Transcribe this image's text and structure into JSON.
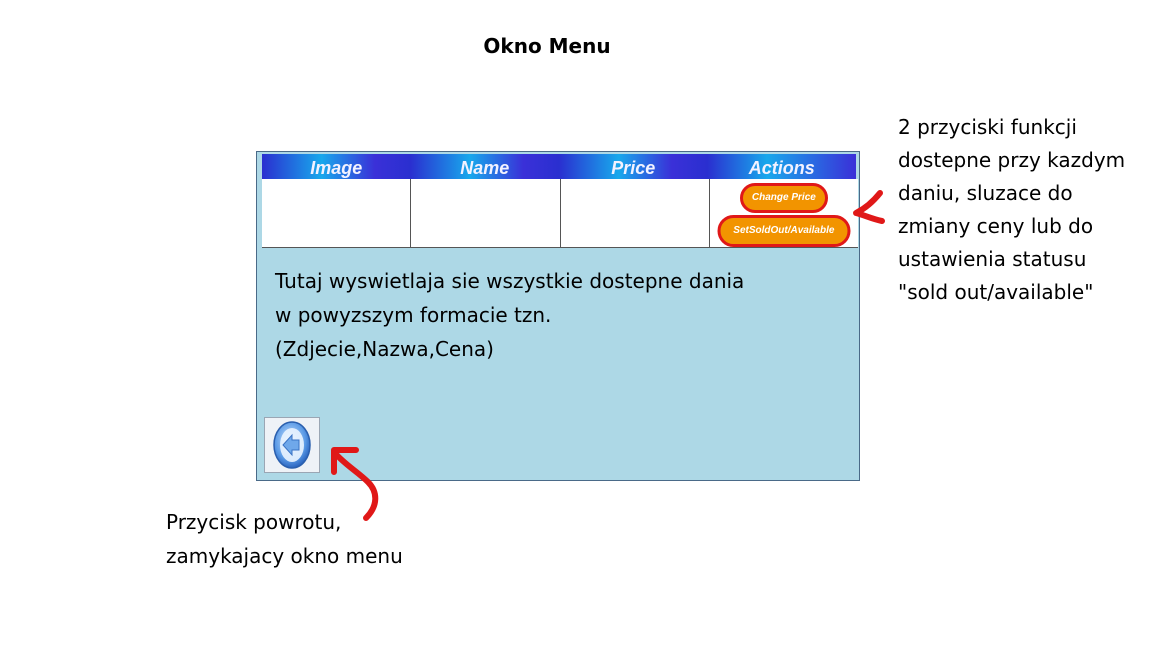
{
  "page": {
    "title": "Okno Menu"
  },
  "menu_window": {
    "table": {
      "columns": [
        "Image",
        "Name",
        "Price",
        "Actions"
      ],
      "actions": {
        "change_price": "Change Price",
        "set_status": "SetSoldOut/Available"
      }
    },
    "description": [
      "Tutaj wyswietlaja sie wszystkie dostepne dania",
      "w powyzszym formacie tzn.",
      "(Zdjecie,Nazwa,Cena)"
    ],
    "back_button": {
      "icon": "back-arrow-icon"
    }
  },
  "annotations": {
    "actions_note": [
      "2 przyciski funkcji",
      "dostepne przy kazdym",
      "daniu, sluzace do",
      "zmiany ceny lub do",
      "ustawienia statusu",
      "\"sold out/available\""
    ],
    "back_note": [
      "Przycisk powrotu,",
      "zamykajacy okno menu"
    ],
    "arrow_color": "#e01818"
  },
  "colors": {
    "window_bg": "#add8e6",
    "header_blue": "#2a2fd0",
    "header_cyan": "#18a8ec",
    "pill_fill": "#f29400",
    "pill_border": "#e01818"
  }
}
